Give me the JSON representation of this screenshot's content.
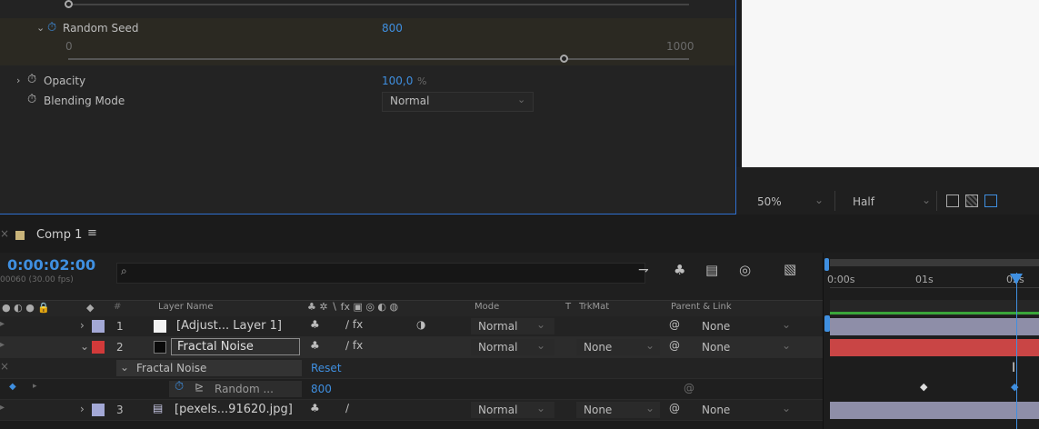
{
  "effect_controls": {
    "random_seed": {
      "label": "Random Seed",
      "value": "800",
      "min": "0",
      "max": "1000",
      "level": 0.8
    },
    "opacity": {
      "label": "Opacity",
      "value": "100,0",
      "unit": "%"
    },
    "blending_mode": {
      "label": "Blending Mode",
      "value": "Normal"
    }
  },
  "viewer_bar": {
    "zoom": "50%",
    "resolution": "Half"
  },
  "comp_tab": {
    "label": "Comp 1",
    "menu_icon": "≡"
  },
  "timeline": {
    "timecode": "0:00:02:00",
    "frames": "00060 (30.00 fps)",
    "search_placeholder": "",
    "columns": {
      "hash": "#",
      "layer_name": "Layer Name",
      "mode": "Mode",
      "t": "T",
      "trkmat": "TrkMat",
      "parent_link": "Parent & Link"
    },
    "ruler": [
      "0:00s",
      "01s",
      "02s"
    ],
    "layers": [
      {
        "num": "1",
        "name": "[Adjust... Layer 1]",
        "mode": "Normal",
        "trkmat": "",
        "parent": "None",
        "label_color": "#a3a8d6",
        "swatch": "#f2f2f2"
      },
      {
        "num": "2",
        "name": "Fractal Noise",
        "mode": "Normal",
        "trkmat": "None",
        "parent": "None",
        "label_color": "#d23a3a",
        "swatch": "#0a0a0a"
      },
      {
        "num": "3",
        "name": "[pexels...91620.jpg]",
        "mode": "Normal",
        "trkmat": "None",
        "parent": "None",
        "label_color": "#a3a8d6",
        "swatch": "#cfcfe8"
      }
    ],
    "effect_group": {
      "name": "Fractal Noise",
      "reset": "Reset"
    },
    "property": {
      "name": "Random ...",
      "value": "800"
    }
  },
  "colors": {
    "accent": "#3f8fe0",
    "layer2_bar": "#c94545",
    "layer_bar": "#8e8ea8"
  }
}
